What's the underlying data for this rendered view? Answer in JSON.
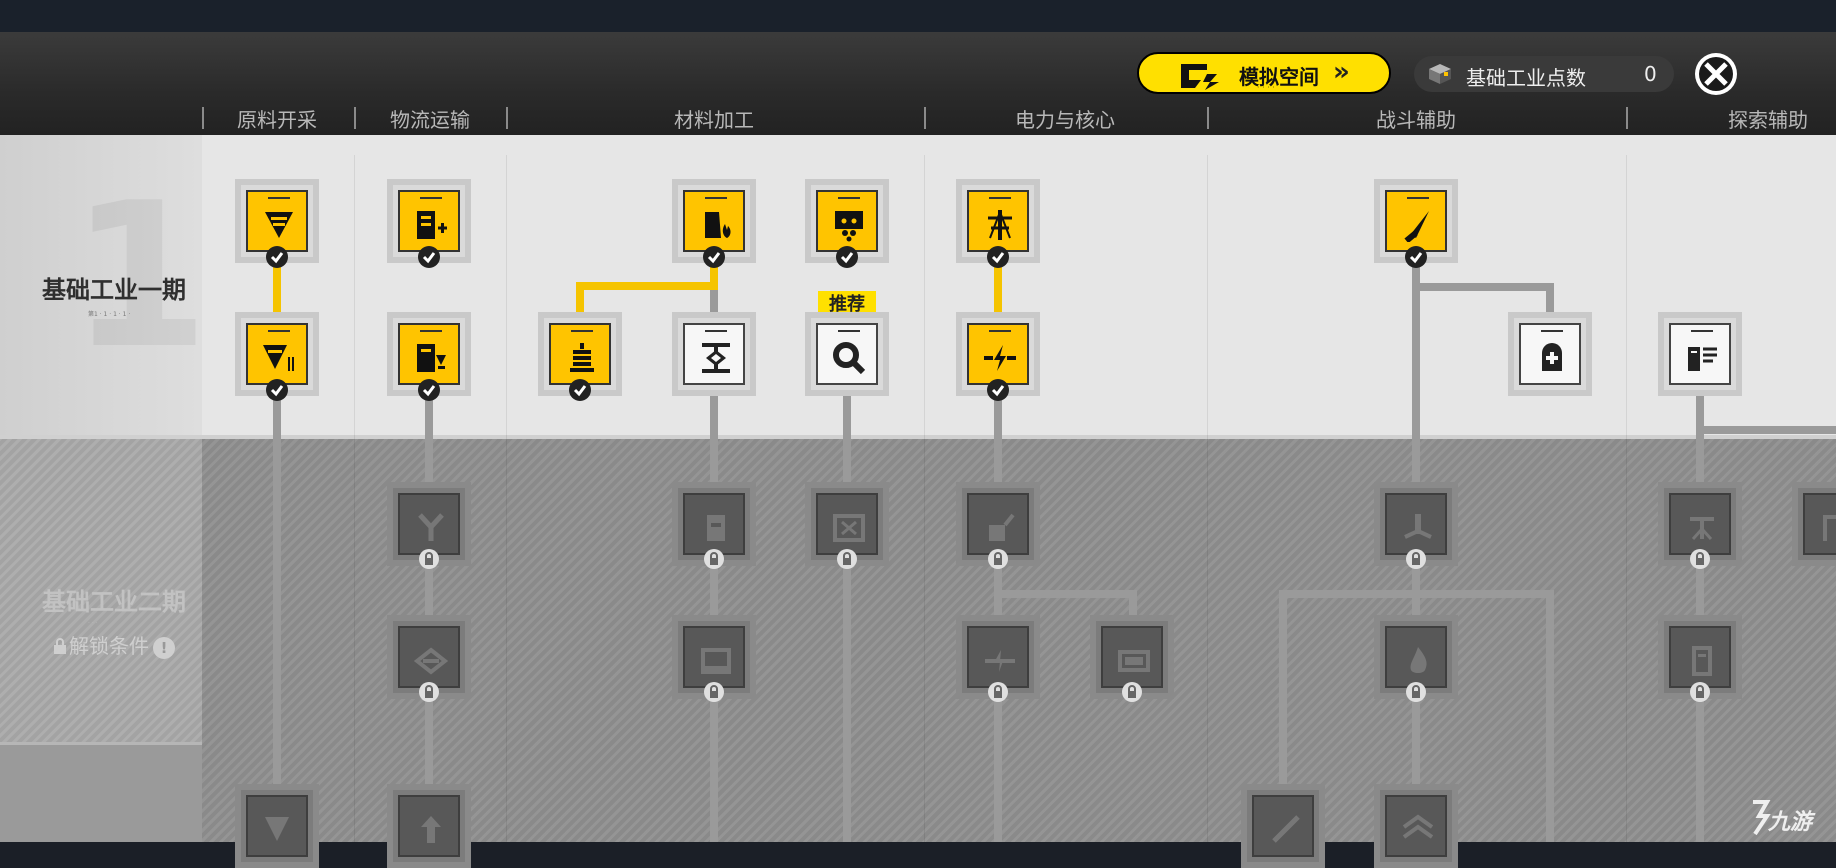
{
  "header": {
    "simulation_button": {
      "label": "模拟空间"
    },
    "points": {
      "label": "基础工业点数",
      "value": "0"
    }
  },
  "categories": [
    "原料开采",
    "物流运输",
    "材料加工",
    "电力与核心",
    "战斗辅助",
    "探索辅助"
  ],
  "tiers": [
    {
      "title": "基础工业一期",
      "subtitle": "第1 · 1 · 1 · 1 ·"
    },
    {
      "title": "基础工业二期",
      "unlock_label": "解锁条件"
    }
  ],
  "recommend_label": "推荐",
  "watermark": "九游",
  "colors": {
    "accent": "#ffc400",
    "button": "#ffe000",
    "link": "#f5c400",
    "link_locked": "#9a9a9a"
  }
}
